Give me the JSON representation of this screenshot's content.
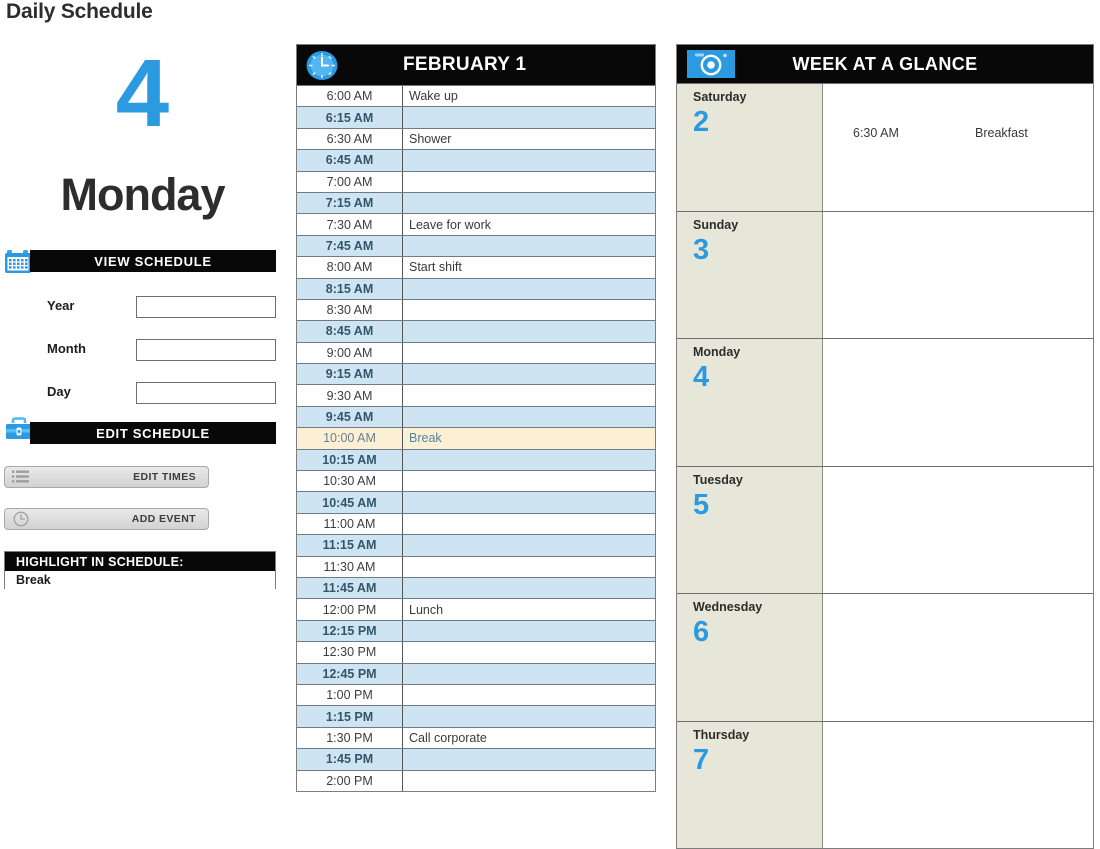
{
  "app": {
    "title": "Daily Schedule"
  },
  "hero": {
    "date_number": "4",
    "day_name": "Monday"
  },
  "view_schedule": {
    "header_label": "VIEW SCHEDULE",
    "icon": "calendar-icon",
    "fields": [
      {
        "label": "Year",
        "value": "",
        "placeholder": ""
      },
      {
        "label": "Month",
        "value": "",
        "placeholder": ""
      },
      {
        "label": "Day",
        "value": "",
        "placeholder": ""
      }
    ]
  },
  "edit_schedule": {
    "header_label": "EDIT SCHEDULE",
    "icon": "toolbox-icon",
    "buttons": [
      {
        "label": "EDIT TIMES",
        "icon": "list-icon"
      },
      {
        "label": "ADD EVENT",
        "icon": "clock-icon"
      }
    ]
  },
  "highlight": {
    "header_label": "HIGHLIGHT IN SCHEDULE:",
    "value": "Break"
  },
  "schedule": {
    "icon": "clock-icon",
    "title": "FEBRUARY 1",
    "highlight_term": "Break",
    "rows": [
      {
        "time": "6:00 AM",
        "event": "Wake up"
      },
      {
        "time": "6:15 AM",
        "event": ""
      },
      {
        "time": "6:30 AM",
        "event": "Shower"
      },
      {
        "time": "6:45 AM",
        "event": ""
      },
      {
        "time": "7:00 AM",
        "event": ""
      },
      {
        "time": "7:15 AM",
        "event": ""
      },
      {
        "time": "7:30 AM",
        "event": "Leave for work"
      },
      {
        "time": "7:45 AM",
        "event": ""
      },
      {
        "time": "8:00 AM",
        "event": "Start shift"
      },
      {
        "time": "8:15 AM",
        "event": ""
      },
      {
        "time": "8:30 AM",
        "event": ""
      },
      {
        "time": "8:45 AM",
        "event": ""
      },
      {
        "time": "9:00 AM",
        "event": ""
      },
      {
        "time": "9:15 AM",
        "event": ""
      },
      {
        "time": "9:30 AM",
        "event": ""
      },
      {
        "time": "9:45 AM",
        "event": ""
      },
      {
        "time": "10:00 AM",
        "event": "Break"
      },
      {
        "time": "10:15 AM",
        "event": ""
      },
      {
        "time": "10:30 AM",
        "event": ""
      },
      {
        "time": "10:45 AM",
        "event": ""
      },
      {
        "time": "11:00 AM",
        "event": ""
      },
      {
        "time": "11:15 AM",
        "event": ""
      },
      {
        "time": "11:30 AM",
        "event": ""
      },
      {
        "time": "11:45 AM",
        "event": ""
      },
      {
        "time": "12:00 PM",
        "event": "Lunch"
      },
      {
        "time": "12:15 PM",
        "event": ""
      },
      {
        "time": "12:30 PM",
        "event": ""
      },
      {
        "time": "12:45 PM",
        "event": ""
      },
      {
        "time": "1:00 PM",
        "event": ""
      },
      {
        "time": "1:15 PM",
        "event": ""
      },
      {
        "time": "1:30 PM",
        "event": "Call corporate"
      },
      {
        "time": "1:45 PM",
        "event": ""
      },
      {
        "time": "2:00 PM",
        "event": ""
      }
    ]
  },
  "week": {
    "icon": "camera-icon",
    "title": "WEEK AT A GLANCE",
    "days": [
      {
        "name": "Saturday",
        "number": "2",
        "events": [
          {
            "time": "6:30 AM",
            "event": "Breakfast"
          }
        ]
      },
      {
        "name": "Sunday",
        "number": "3",
        "events": []
      },
      {
        "name": "Monday",
        "number": "4",
        "events": []
      },
      {
        "name": "Tuesday",
        "number": "5",
        "events": []
      },
      {
        "name": "Wednesday",
        "number": "6",
        "events": []
      },
      {
        "name": "Thursday",
        "number": "7",
        "events": []
      }
    ]
  },
  "colors": {
    "accent_blue": "#2b9ae0",
    "bar_black": "#080808",
    "row_stripe_blue": "#cfe4f2",
    "highlight_cream": "#fcf0d4",
    "week_day_beige": "#e6e7d8"
  }
}
